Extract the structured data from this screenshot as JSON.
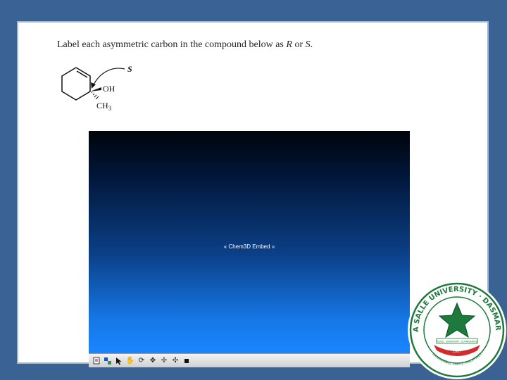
{
  "question": {
    "prefix": "Label each asymmetric carbon in the compound below as ",
    "opt_r": "R",
    "or": " or ",
    "opt_s": "S",
    "suffix": "."
  },
  "molecule": {
    "stereo_label": "S",
    "oh_label": "OH",
    "ch_label": "CH",
    "ch_subscript": "3"
  },
  "embed": {
    "label": "« Chem3D Embed »"
  },
  "toolbar": {
    "icons": [
      "document-icon",
      "select-icon",
      "arrow-icon",
      "hand-icon",
      "rotate-icon",
      "zoom-icon",
      "translate-icon",
      "move-icon",
      "stop-icon"
    ]
  },
  "logo": {
    "university": "DE LA SALLE UNIVERSITY · DASMARIÑAS",
    "year": "1987",
    "motto": "FIDES · SERVITIUM · COMMUNITAS",
    "location": "DASMARIÑAS, CAVITE, PHILIPPINES"
  },
  "colors": {
    "background": "#3a6394",
    "logo_green": "#1e7a3c",
    "logo_red": "#d22b2b"
  }
}
